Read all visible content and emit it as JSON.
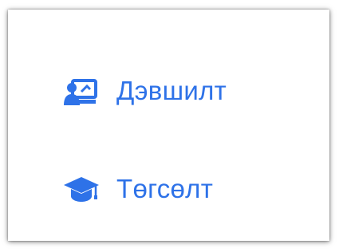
{
  "theme": {
    "accent": "#2E72E8"
  },
  "menu": {
    "items": [
      {
        "label": "Дэвшилт",
        "icon": "presentation-icon"
      },
      {
        "label": "Төгсөлт",
        "icon": "graduation-cap-icon"
      }
    ]
  }
}
